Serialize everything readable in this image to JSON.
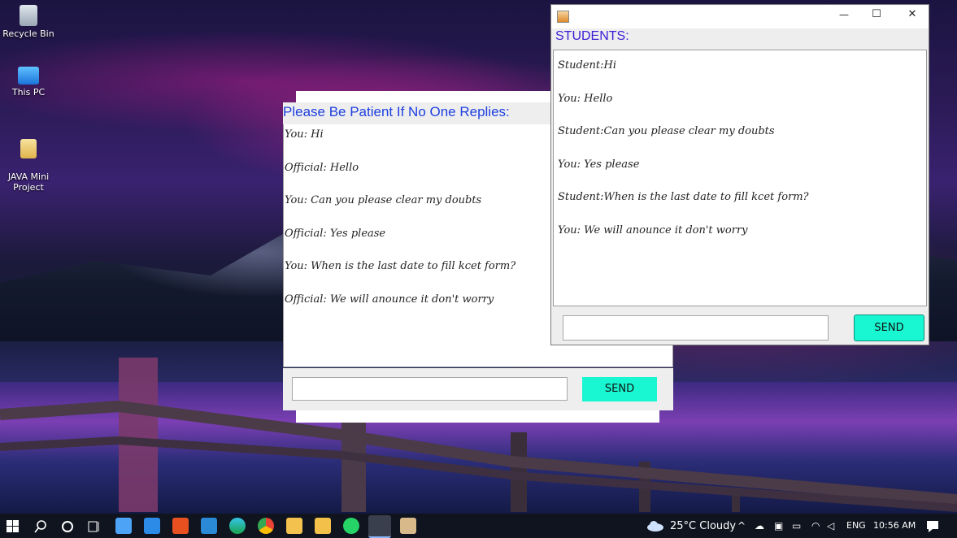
{
  "desktop": {
    "icons": [
      {
        "label": "Recycle Bin"
      },
      {
        "label": "This PC"
      },
      {
        "label": "JAVA Mini\nProject"
      }
    ]
  },
  "official_window": {
    "heading": "Please Be Patient If No One Replies:",
    "messages": [
      "You: Hi",
      "Official: Hello",
      "You: Can you please clear my doubts",
      "Official: Yes please",
      "You: When is the last date to fill kcet form?",
      "Official: We will anounce it don't worry"
    ],
    "input_value": "",
    "send_label": "SEND"
  },
  "students_window": {
    "heading": "STUDENTS:",
    "messages": [
      "Student:Hi",
      "You: Hello",
      "Student:Can you please clear my doubts",
      "You: Yes please",
      "Student:When is the last date to fill kcet form?",
      "You: We will anounce it don't worry"
    ],
    "input_value": "",
    "send_label": "SEND",
    "controls": {
      "minimize": "—",
      "maximize": "☐",
      "close": "✕"
    }
  },
  "taskbar": {
    "weather": "25°C  Cloudy",
    "language": "ENG",
    "time": "10:56 AM"
  },
  "colors": {
    "heading_blue": "#1e3fe0",
    "students_heading": "#3b1bd6",
    "send_button": "#19f7d2",
    "taskbar_bg": "#10141f"
  }
}
